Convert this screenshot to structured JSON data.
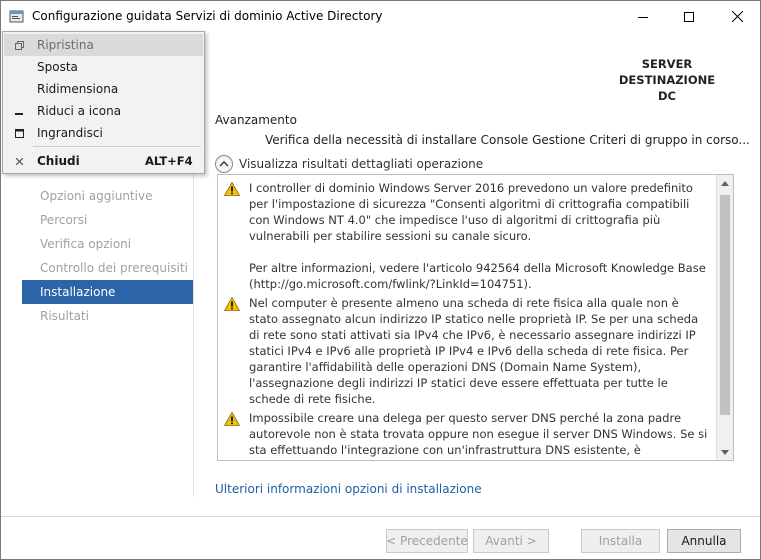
{
  "window": {
    "title": "Configurazione guidata Servizi di dominio Active Directory",
    "destination_label_line1": "SERVER DESTINAZIONE",
    "destination_label_line2": "DC"
  },
  "sidebar": {
    "items": [
      {
        "label": "Opzioni aggiuntive",
        "state": "disabled"
      },
      {
        "label": "Percorsi",
        "state": "disabled"
      },
      {
        "label": "Verifica opzioni",
        "state": "disabled"
      },
      {
        "label": "Controllo dei prerequisiti",
        "state": "disabled"
      },
      {
        "label": "Installazione",
        "state": "active"
      },
      {
        "label": "Risultati",
        "state": "disabled"
      }
    ]
  },
  "main": {
    "progress_label": "Avanzamento",
    "progress_status": "Verifica della necessità di installare Console Gestione Criteri di gruppo in corso...",
    "toggle_label": "Visualizza risultati dettagliati operazione",
    "messages": [
      {
        "icon": "warning-icon",
        "paragraph1": "I controller di dominio Windows Server 2016 prevedono un valore predefinito per l'impostazione di sicurezza \"Consenti algoritmi di crittografia compatibili con Windows NT 4.0\" che impedisce l'uso di algoritmi di crittografia più vulnerabili per stabilire sessioni su canale sicuro.",
        "paragraph2": "Per altre informazioni, vedere l'articolo 942564 della Microsoft Knowledge Base (http://go.microsoft.com/fwlink/?LinkId=104751)."
      },
      {
        "icon": "warning-icon",
        "paragraph1": "Nel computer è presente almeno una scheda di rete fisica alla quale non è stato assegnato alcun indirizzo IP statico nelle proprietà IP. Se per una scheda di rete sono stati attivati sia IPv4 che IPv6, è necessario assegnare indirizzi IP statici IPv4 e IPv6 alle proprietà IP IPv4 e IPv6 della scheda di rete fisica. Per garantire l'affidabilità delle operazioni DNS (Domain Name System), l'assegnazione degli indirizzi IP statici deve essere effettuata per tutte le schede di rete fisiche."
      },
      {
        "icon": "warning-icon",
        "paragraph1": "Impossibile creare una delega per questo server DNS perché la zona padre autorevole non è stata trovata oppure non esegue il server DNS Windows. Se si sta effettuando l'integrazione con un'infrastruttura DNS esistente, è consigliabile creare manualmente una delega per il server DNS nella zona padre per garantire una risoluzione dei nomi"
      }
    ],
    "more_info_link": "Ulteriori informazioni opzioni di installazione"
  },
  "footer": {
    "prev_label": "< Precedente",
    "next_label": "Avanti >",
    "install_label": "Installa",
    "cancel_label": "Annulla"
  },
  "system_menu": {
    "items": [
      {
        "icon": "restore-icon",
        "label": "Ripristina",
        "shortcut": "",
        "state": "disabled-highlighted"
      },
      {
        "icon": "",
        "label": "Sposta",
        "shortcut": "",
        "state": "enabled"
      },
      {
        "icon": "",
        "label": "Ridimensiona",
        "shortcut": "",
        "state": "enabled"
      },
      {
        "icon": "minimize-icon",
        "label": "Riduci a icona",
        "shortcut": "",
        "state": "enabled"
      },
      {
        "icon": "maximize-icon",
        "label": "Ingrandisci",
        "shortcut": "",
        "state": "enabled"
      },
      {
        "icon": "close-icon",
        "label": "Chiudi",
        "shortcut": "ALT+F4",
        "state": "enabled"
      }
    ]
  },
  "colors": {
    "active_nav": "#2b65a8",
    "link": "#1d5fa6",
    "warning": "#f2c10d"
  }
}
